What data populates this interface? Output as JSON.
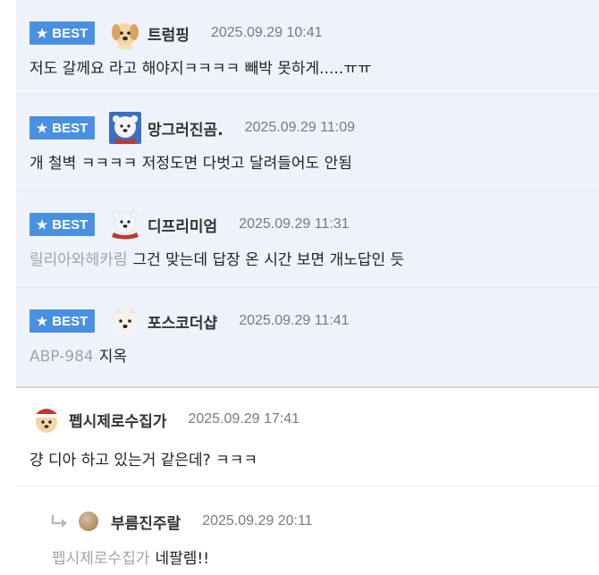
{
  "best_badge_label": "BEST",
  "best_comments": [
    {
      "nickname": "트럼핑",
      "date": "2025.09.29 10:41",
      "mention": "",
      "text": "저도 갈께요 라고 해야지ㅋㅋㅋㅋ 빼박 못하게.....ㅠㅠ",
      "avatar": "puppy-avatar-icon"
    },
    {
      "nickname": "망그러진곰.",
      "date": "2025.09.29 11:09",
      "mention": "",
      "text": "개 철벽 ㅋㅋㅋㅋ 저정도면 다벗고 달려들어도 안됨",
      "avatar": "polar-bear-avatar-icon"
    },
    {
      "nickname": "디프리미엄",
      "date": "2025.09.29 11:31",
      "mention": "릴리아와헤카림",
      "text": "그건 맞는데 답장 온 시간 보면 개노답인 듯",
      "avatar": "polar-bear-scarf-avatar-icon"
    },
    {
      "nickname": "포스코더샵",
      "date": "2025.09.29 11:41",
      "mention": "ABP-984",
      "text": "지옥",
      "avatar": "white-dog-avatar-icon"
    }
  ],
  "comment": {
    "nickname": "펩시제로수집가",
    "date": "2025.09.29 17:41",
    "text": "걍 디아 하고 있는거 같은데? ㅋㅋㅋ",
    "avatar": "puppy-hat-avatar-icon"
  },
  "reply": {
    "nickname": "부름진주랄",
    "date": "2025.09.29 20:11",
    "mention": "펩시제로수집가",
    "text": "네팔렘!!",
    "avatar": "bead-avatar-icon"
  }
}
